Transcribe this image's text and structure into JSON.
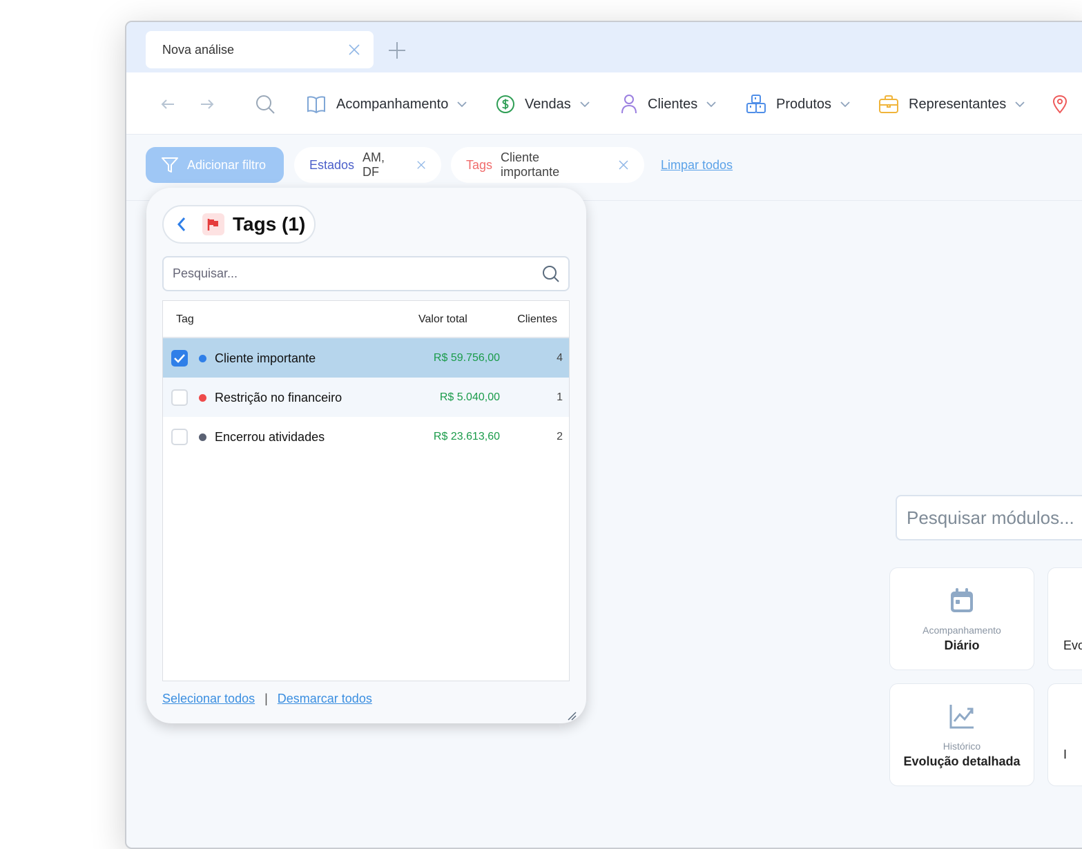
{
  "tab": {
    "label": "Nova análise"
  },
  "nav": {
    "menus": [
      {
        "label": "Acompanhamento",
        "icon": "book-icon"
      },
      {
        "label": "Vendas",
        "icon": "dollar-circle-icon"
      },
      {
        "label": "Clientes",
        "icon": "user-icon"
      },
      {
        "label": "Produtos",
        "icon": "boxes-icon"
      },
      {
        "label": "Representantes",
        "icon": "briefcase-icon"
      }
    ]
  },
  "filters": {
    "add_label": "Adicionar filtro",
    "chips": [
      {
        "key": "Estados",
        "value": "AM, DF",
        "color": "#4a5ec9"
      },
      {
        "key": "Tags",
        "value": "Cliente importante",
        "color": "#f06b6b"
      }
    ],
    "clear_label": "Limpar todos"
  },
  "panel": {
    "title": "Tags (1)",
    "search_placeholder": "Pesquisar...",
    "columns": {
      "tag": "Tag",
      "value": "Valor total",
      "clients": "Clientes"
    },
    "rows": [
      {
        "name": "Cliente importante",
        "value": "R$ 59.756,00",
        "clients": "4",
        "checked": true,
        "dot": "#2f7fe8"
      },
      {
        "name": "Restrição no financeiro",
        "value": "R$ 5.040,00",
        "clients": "1",
        "checked": false,
        "dot": "#ee4b4b"
      },
      {
        "name": "Encerrou atividades",
        "value": "R$ 23.613,60",
        "clients": "2",
        "checked": false,
        "dot": "#5a6173"
      }
    ],
    "select_all": "Selecionar todos",
    "separator": "|",
    "deselect_all": "Desmarcar todos"
  },
  "modules": {
    "search_placeholder": "Pesquisar módulos...",
    "cards": [
      {
        "category": "Acompanhamento",
        "name": "Diário",
        "icon": "calendar-icon"
      },
      {
        "category": "",
        "name": "Evo",
        "icon": ""
      },
      {
        "category": "Histórico",
        "name": "Evolução detalhada",
        "icon": "chart-line-icon"
      },
      {
        "category": "",
        "name": "I",
        "icon": ""
      }
    ]
  }
}
